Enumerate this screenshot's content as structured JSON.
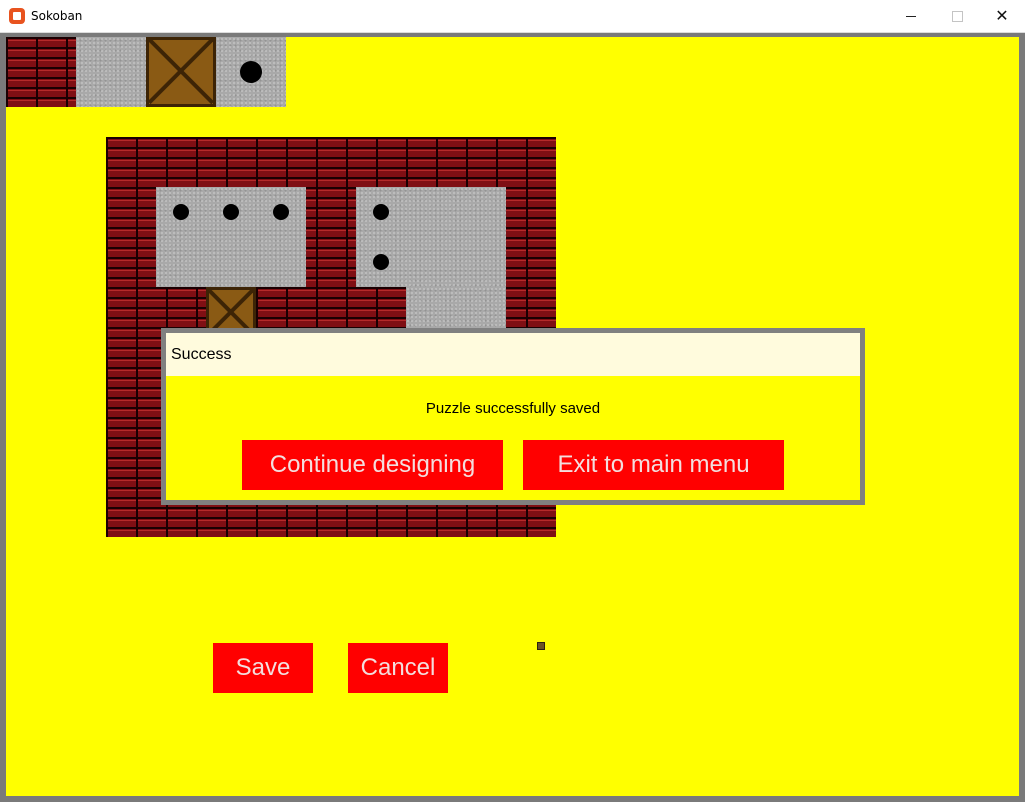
{
  "window": {
    "title": "Sokoban",
    "minimize_glyph": "",
    "maximize_glyph": "",
    "close_glyph": "✕"
  },
  "colors": {
    "background": "#ffff00",
    "button": "#ff0000",
    "button_text": "#f3dede",
    "dialog_header": "#fffbdd",
    "frame": "#808080"
  },
  "palette": {
    "tiles": [
      "wall",
      "floor",
      "crate",
      "target"
    ]
  },
  "editor": {
    "save_label": "Save",
    "cancel_label": "Cancel"
  },
  "dialog": {
    "title": "Success",
    "message": "Puzzle successfully saved",
    "continue_label": "Continue designing",
    "exit_label": "Exit to main menu"
  }
}
